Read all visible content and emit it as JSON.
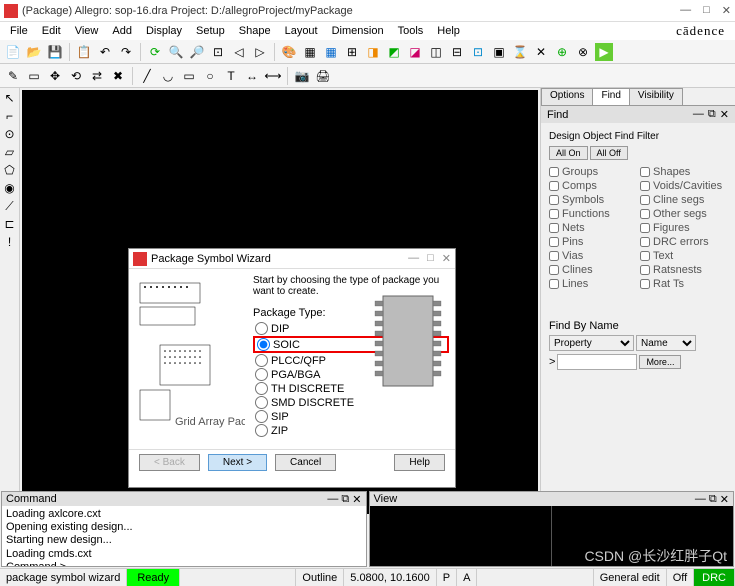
{
  "window": {
    "title": "(Package) Allegro: sop-16.dra  Project: D:/allegroProject/myPackage",
    "brand": "cādence"
  },
  "menu": [
    "File",
    "Edit",
    "View",
    "Add",
    "Display",
    "Setup",
    "Shape",
    "Layout",
    "Dimension",
    "Tools",
    "Help"
  ],
  "right_panel": {
    "tabs": [
      "Options",
      "Find",
      "Visibility"
    ],
    "active_tab": "Find",
    "header": "Find",
    "filter_title": "Design Object Find Filter",
    "btn_allon": "All On",
    "btn_alloff": "All Off",
    "filters_left": [
      "Groups",
      "Comps",
      "Symbols",
      "Functions",
      "Nets",
      "Pins",
      "Vias",
      "Clines",
      "Lines"
    ],
    "filters_right": [
      "Shapes",
      "Voids/Cavities",
      "Cline segs",
      "Other segs",
      "Figures",
      "DRC errors",
      "Text",
      "Ratsnests",
      "Rat Ts"
    ],
    "findbyname": "Find By Name",
    "property": "Property",
    "name": "Name",
    "more": "More..."
  },
  "dialog": {
    "title": "Package Symbol Wizard",
    "instruction": "Start by choosing the type of package you want to create.",
    "pkgtype_label": "Package Type:",
    "options": [
      "DIP",
      "SOIC",
      "PLCC/QFP",
      "PGA/BGA",
      "TH DISCRETE",
      "SMD DISCRETE",
      "SIP",
      "ZIP"
    ],
    "selected": "SOIC",
    "btn_back": "< Back",
    "btn_next": "Next >",
    "btn_cancel": "Cancel",
    "btn_help": "Help"
  },
  "command_pane": {
    "title": "Command",
    "lines": [
      "Loading axlcore.cxt",
      "Opening existing design...",
      "Starting new design...",
      "Loading cmds.cxt",
      "Command >"
    ]
  },
  "view_pane": {
    "title": "View"
  },
  "statusbar": {
    "mode": "package symbol wizard",
    "ready": "Ready",
    "outline": "Outline",
    "coords": "5.0800, 10.1600",
    "p": "P",
    "a": "A",
    "general": "General edit",
    "off": "Off",
    "drc": "DRC"
  },
  "watermark": "CSDN @长沙红胖子Qt"
}
